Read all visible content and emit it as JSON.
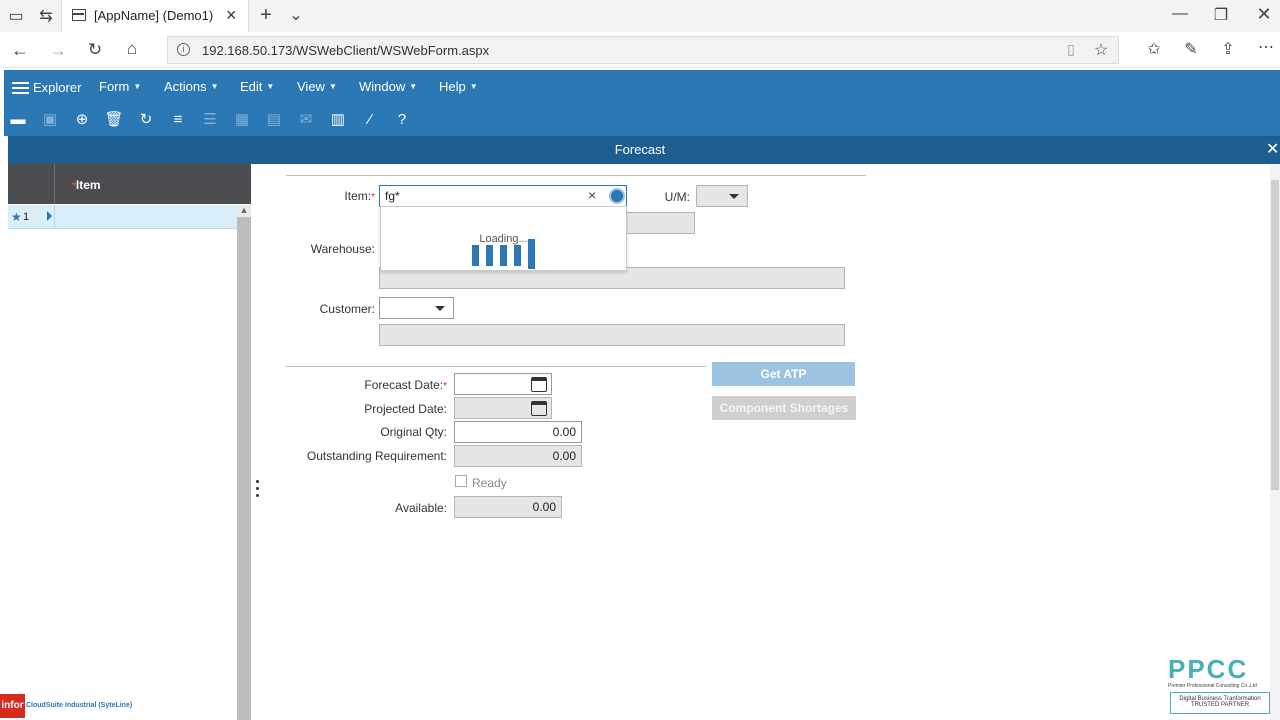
{
  "browser": {
    "tab_title": "[AppName] (Demo1)",
    "url": "192.168.50.173/WSWebClient/WSWebForm.aspx"
  },
  "menu": {
    "explorer": "Explorer",
    "items": [
      "Form",
      "Actions",
      "Edit",
      "View",
      "Window",
      "Help"
    ]
  },
  "toolbar_icons": [
    "open-folder-icon",
    "save-icon",
    "globe-icon",
    "delete-icon",
    "refresh-icon",
    "filter-icon",
    "list-icon",
    "calendar-icon",
    "document-icon",
    "mail-icon",
    "report-icon",
    "brush-icon",
    "help-icon"
  ],
  "form": {
    "title": "Forecast",
    "grid": {
      "column": "Item",
      "rows": [
        {
          "num": "1"
        }
      ]
    },
    "fields": {
      "item_label": "Item:",
      "item_value": "fg*",
      "um_label": "U/M:",
      "warehouse_label": "Warehouse:",
      "customer_label": "Customer:",
      "forecast_date_label": "Forecast Date:",
      "projected_date_label": "Projected Date:",
      "original_qty_label": "Original Qty:",
      "original_qty": "0.00",
      "outstanding_label": "Outstanding Requirement:",
      "outstanding": "0.00",
      "ready_label": "Ready",
      "available_label": "Available:",
      "available": "0.00"
    },
    "loading_text": "Loading...",
    "buttons": {
      "get_atp": "Get ATP",
      "component_shortages": "Component Shortages"
    }
  },
  "footer": {
    "brand": "infor",
    "product": "CloudSuite Industrial (SyteLine)",
    "partner_logo": "PPCC",
    "partner_name": "Premier Professional Consulting Co.,Ltd",
    "partner_tag1": "Digital Business Tranformation",
    "partner_tag2": "TRUSTED PARTNER"
  },
  "colors": {
    "menu_bg": "#2b78b5",
    "title_bg": "#1d5d8f",
    "button_disabled": "#9cc3e2"
  }
}
